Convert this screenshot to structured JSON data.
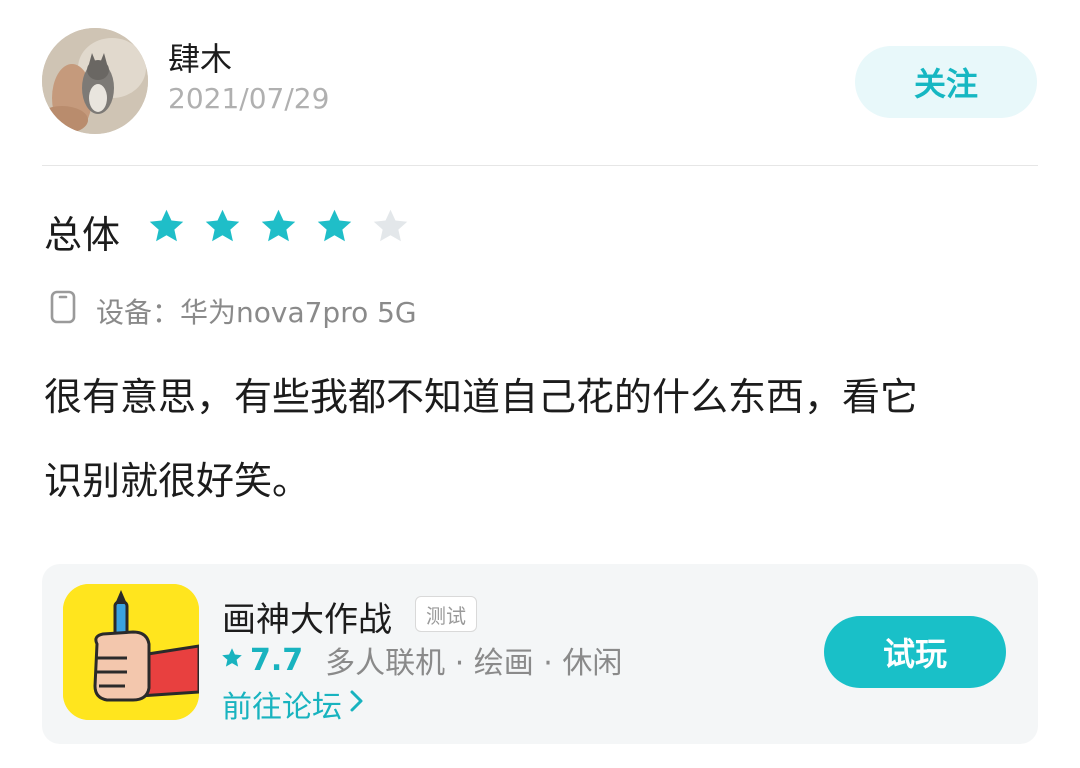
{
  "user": {
    "name": "肆木",
    "date": "2021/07/29",
    "follow_label": "关注"
  },
  "rating": {
    "label": "总体",
    "stars": 4,
    "max_stars": 5,
    "star_color": "#1fbec8",
    "empty_star_color": "#e3e7ea"
  },
  "device": {
    "text": "设备：华为nova7pro 5G",
    "icon": "phone-icon"
  },
  "review": {
    "line1": "很有意思，有些我都不知道自己花的什么东西，看它",
    "line2": "识别就很好笑。"
  },
  "game": {
    "title": "画神大作战",
    "badge": "测试",
    "score": "7.7",
    "tags": "多人联机 · 绘画 · 休闲",
    "forum_link": "前往论坛",
    "play_label": "试玩",
    "accent_color": "#18b3bf"
  }
}
